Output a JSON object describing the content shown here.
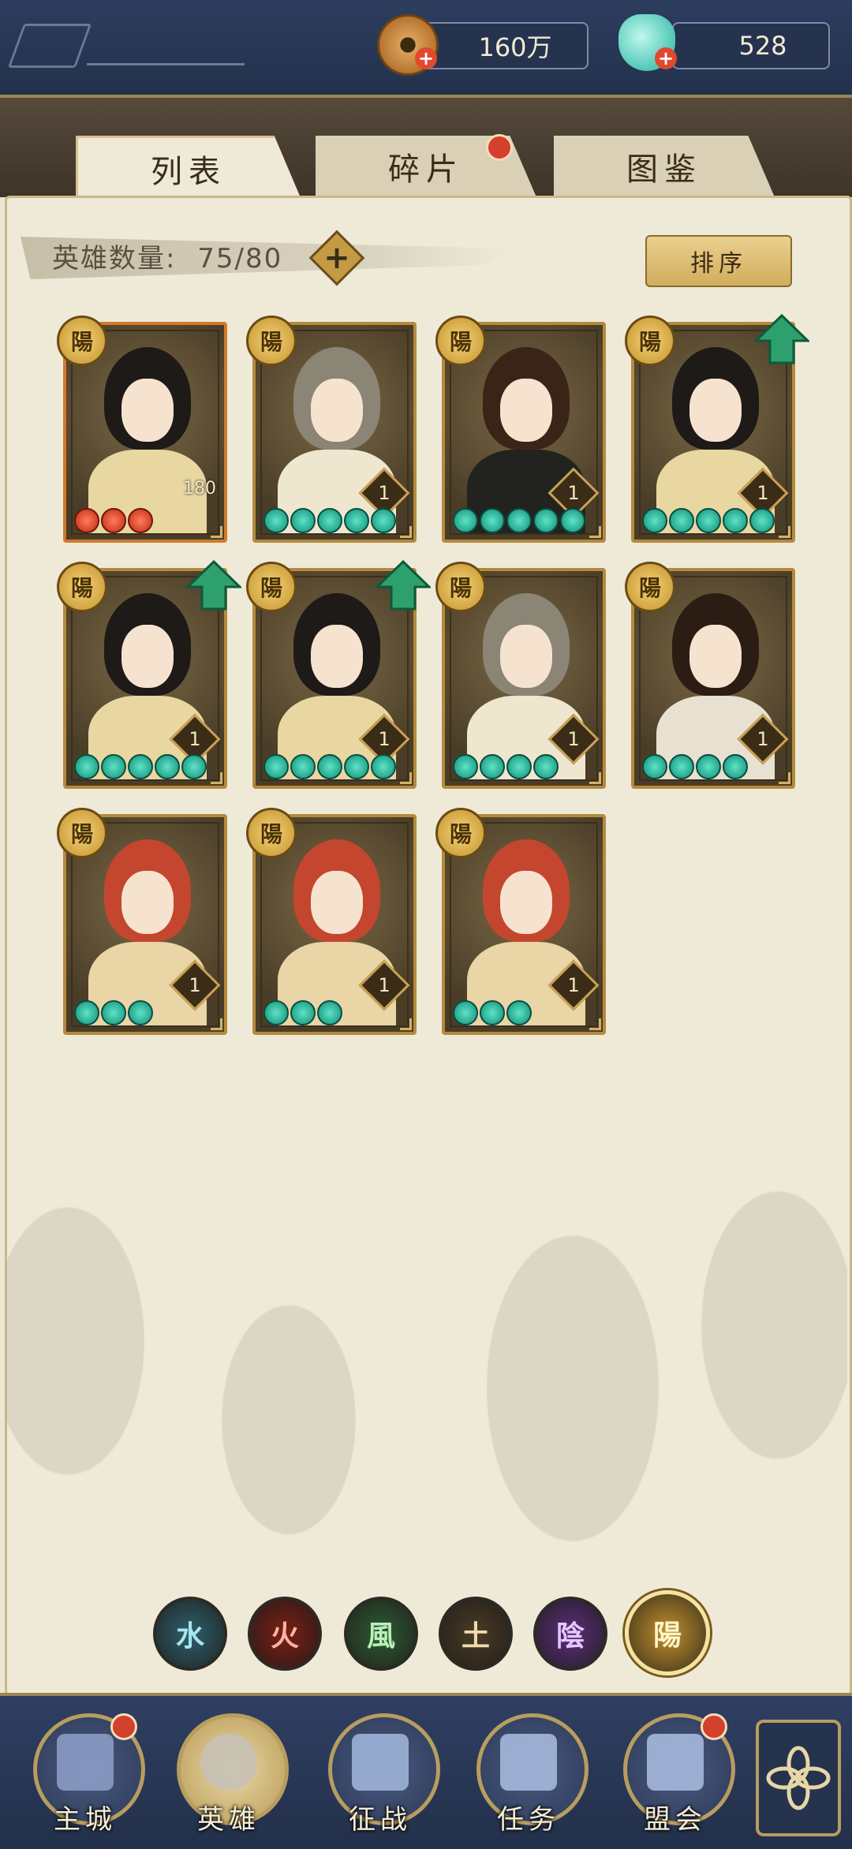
{
  "resources": {
    "coins": "160万",
    "jade": "528"
  },
  "tabs": [
    {
      "label": "列表",
      "active": true
    },
    {
      "label": "碎片",
      "active": false,
      "badge": true
    },
    {
      "label": "图鉴",
      "active": false
    }
  ],
  "hero_count": {
    "label": "英雄数量:",
    "value": "75/80"
  },
  "sort_label": "排序",
  "yang_glyph": "陽",
  "cards": [
    {
      "hero": "female-white-robe",
      "level": "180",
      "stars": 3,
      "star_color": "red",
      "upgrade": false
    },
    {
      "hero": "grey-haired-man",
      "level": "1",
      "stars": 5,
      "star_color": "teal",
      "upgrade": false
    },
    {
      "hero": "dark-haired-general",
      "level": "1",
      "stars": 5,
      "star_color": "teal",
      "upgrade": false
    },
    {
      "hero": "female-white-robe",
      "level": "1",
      "stars": 5,
      "star_color": "teal",
      "upgrade": true
    },
    {
      "hero": "female-white-robe",
      "level": "1",
      "stars": 5,
      "star_color": "teal",
      "upgrade": true
    },
    {
      "hero": "female-white-robe",
      "level": "1",
      "stars": 5,
      "star_color": "teal",
      "upgrade": true
    },
    {
      "hero": "grey-haired-man",
      "level": "1",
      "stars": 4,
      "star_color": "teal",
      "upgrade": false
    },
    {
      "hero": "long-haired-lady",
      "level": "1",
      "stars": 4,
      "star_color": "teal",
      "upgrade": false
    },
    {
      "hero": "red-haired-girl",
      "level": "1",
      "stars": 3,
      "star_color": "teal",
      "upgrade": false
    },
    {
      "hero": "red-haired-girl",
      "level": "1",
      "stars": 3,
      "star_color": "teal",
      "upgrade": false
    },
    {
      "hero": "red-haired-girl",
      "level": "1",
      "stars": 3,
      "star_color": "teal",
      "upgrade": false
    }
  ],
  "elements": [
    {
      "glyph": "水",
      "name": "water",
      "color": "#2f5f6c",
      "text": "#a7e6ef"
    },
    {
      "glyph": "火",
      "name": "fire",
      "color": "#7a1f16",
      "text": "#ffb3a0"
    },
    {
      "glyph": "風",
      "name": "wind",
      "color": "#2f5a34",
      "text": "#b8f0b8"
    },
    {
      "glyph": "土",
      "name": "earth",
      "color": "#4a3b26",
      "text": "#f1dcaa"
    },
    {
      "glyph": "陰",
      "name": "yin",
      "color": "#5a2e7a",
      "text": "#e7c7ff"
    },
    {
      "glyph": "陽",
      "name": "yang",
      "color": "#c2912d",
      "text": "#fff4c9",
      "selected": true
    }
  ],
  "nav": [
    {
      "label": "主城",
      "badge": true
    },
    {
      "label": "英雄",
      "badge": false,
      "active": true
    },
    {
      "label": "征战",
      "badge": false
    },
    {
      "label": "任务",
      "badge": false
    },
    {
      "label": "盟会",
      "badge": true
    }
  ]
}
